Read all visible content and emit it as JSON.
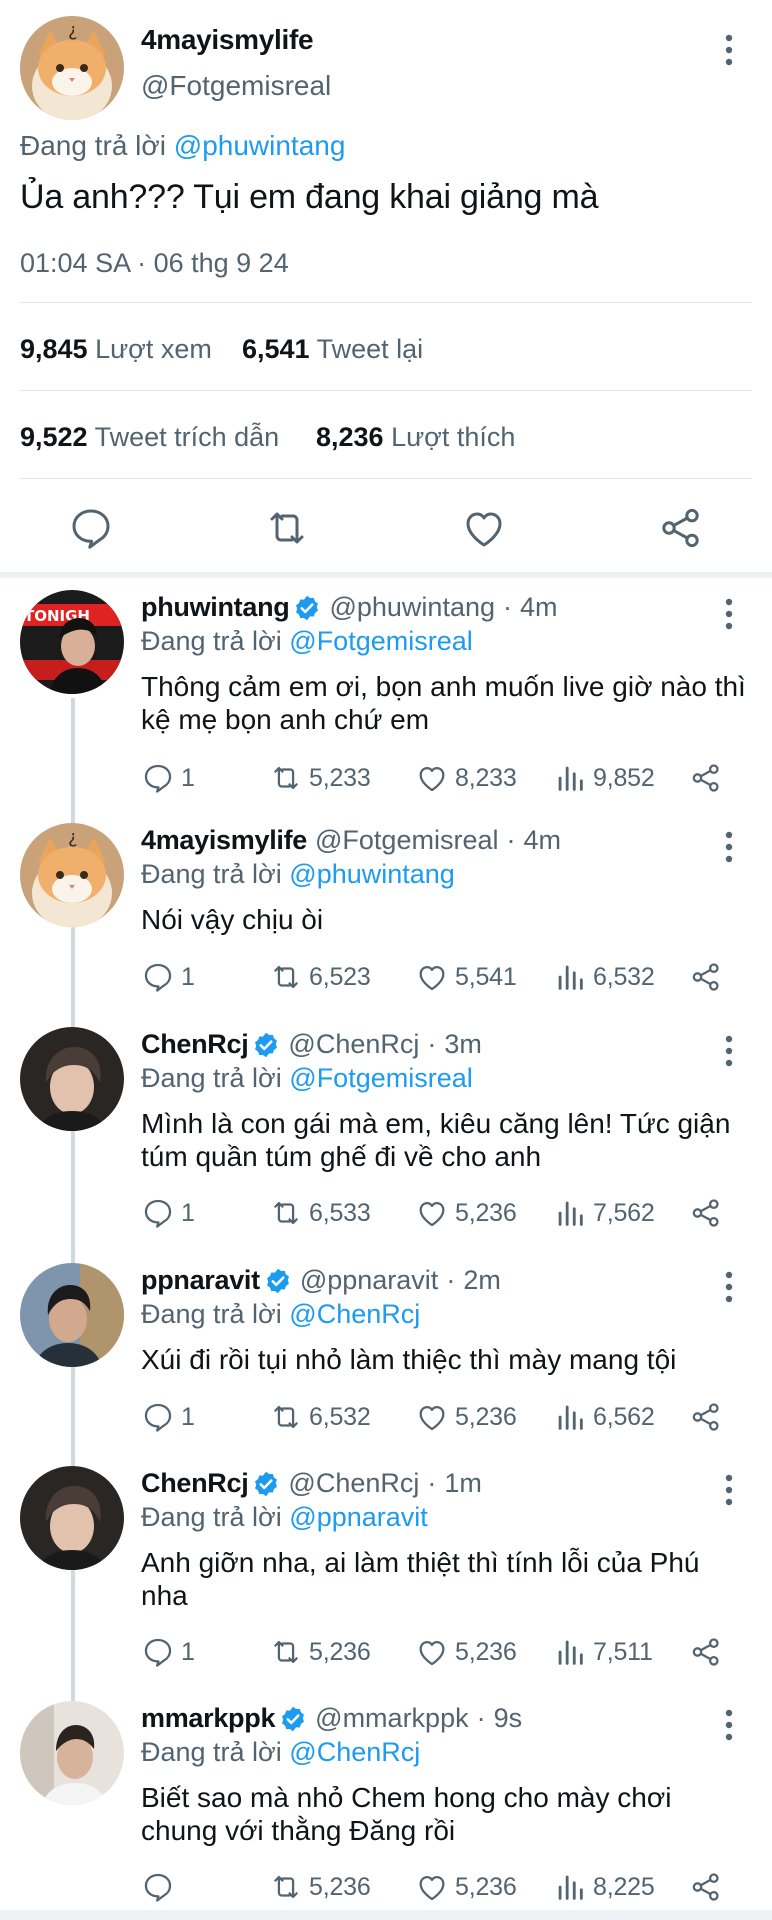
{
  "main_tweet": {
    "display_name": "4mayismylife",
    "handle": "@Fotgemisreal",
    "replying_prefix": "Đang trả lời",
    "replying_to": "@phuwintang",
    "text": "Ủa anh??? Tụi em đang khai giảng mà",
    "timestamp": "01:04 SA · 06 thg 9 24",
    "stats": {
      "views_count": "9,845",
      "views_label": "Lượt xem",
      "retweets_count": "6,541",
      "retweets_label": "Tweet lại",
      "quotes_count": "9,522",
      "quotes_label": "Tweet trích dẫn",
      "likes_count": "8,236",
      "likes_label": "Lượt thích"
    },
    "actions": [
      "reply-icon",
      "retweet-icon",
      "like-icon",
      "share-icon"
    ]
  },
  "replies": [
    {
      "display_name": "phuwintang",
      "verified": true,
      "handle": "@phuwintang",
      "age": "4m",
      "replying_prefix": "Đang trả lời",
      "replying_to": "@Fotgemisreal",
      "text": "Thông cảm em ơi, bọn anh muốn live giờ nào thì kệ mẹ bọn anh chứ em",
      "replies": "1",
      "retweets": "5,233",
      "likes": "8,233",
      "views": "9,852"
    },
    {
      "display_name": "4mayismylife",
      "verified": false,
      "handle": "@Fotgemisreal",
      "age": "4m",
      "replying_prefix": "Đang trả lời",
      "replying_to": "@phuwintang",
      "text": "Nói vậy chịu òi",
      "replies": "1",
      "retweets": "6,523",
      "likes": "5,541",
      "views": "6,532"
    },
    {
      "display_name": "ChenRcj",
      "verified": true,
      "handle": "@ChenRcj",
      "age": "3m",
      "replying_prefix": "Đang trả lời",
      "replying_to": "@Fotgemisreal",
      "text": "Mình là con gái mà em, kiêu căng lên! Tức giận túm quần túm ghế đi về cho anh",
      "replies": "1",
      "retweets": "6,533",
      "likes": "5,236",
      "views": "7,562"
    },
    {
      "display_name": "ppnaravit",
      "verified": true,
      "handle": "@ppnaravit",
      "age": "2m",
      "replying_prefix": "Đang trả lời",
      "replying_to": "@ChenRcj",
      "text": "Xúi đi rồi tụi nhỏ làm thiệc thì mày mang tội",
      "replies": "1",
      "retweets": "6,532",
      "likes": "5,236",
      "views": "6,562"
    },
    {
      "display_name": "ChenRcj",
      "verified": true,
      "handle": "@ChenRcj",
      "age": "1m",
      "replying_prefix": "Đang trả lời",
      "replying_to": "@ppnaravit",
      "text": "Anh giỡn nha, ai làm thiệt thì tính lỗi của Phú nha",
      "replies": "1",
      "retweets": "5,236",
      "likes": "5,236",
      "views": "7,511"
    },
    {
      "display_name": "mmarkppk",
      "verified": true,
      "handle": "@mmarkppk",
      "age": "9s",
      "replying_prefix": "Đang trả lời",
      "replying_to": "@ChenRcj",
      "text": "Biết sao mà nhỏ Chem hong cho mày chơi chung với thằng Đăng rồi",
      "replies": "",
      "retweets": "5,236",
      "likes": "5,236",
      "views": "8,225"
    }
  ],
  "colors": {
    "accent": "#1d9bf0",
    "muted": "#536471",
    "text": "#0f1419",
    "divider": "#e1e6ea"
  }
}
